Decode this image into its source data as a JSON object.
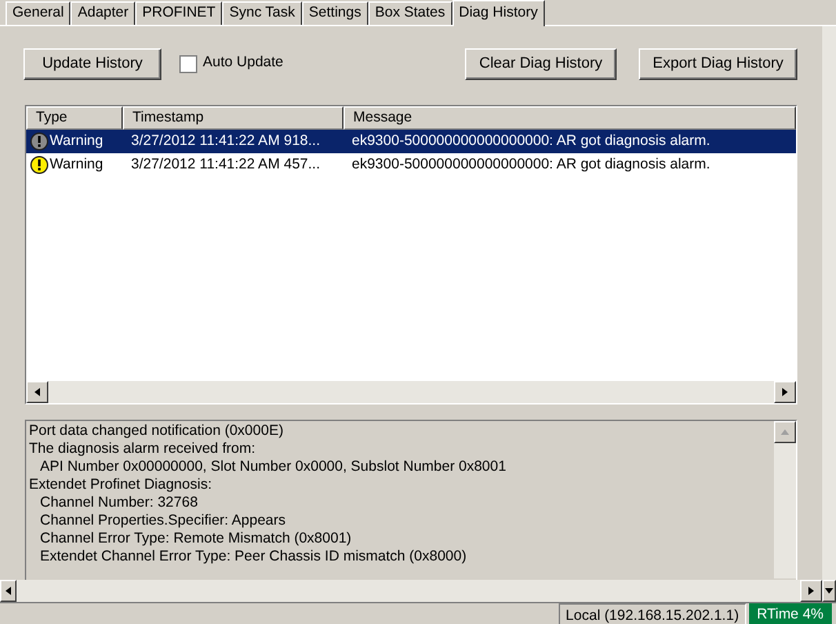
{
  "tabs": [
    {
      "label": "General",
      "selected": false
    },
    {
      "label": "Adapter",
      "selected": false
    },
    {
      "label": "PROFINET",
      "selected": false
    },
    {
      "label": "Sync Task",
      "selected": false
    },
    {
      "label": "Settings",
      "selected": false
    },
    {
      "label": "Box States",
      "selected": false
    },
    {
      "label": "Diag History",
      "selected": true
    }
  ],
  "toolbar": {
    "update_button": "Update History",
    "auto_update": {
      "label": "Auto Update",
      "checked": false
    },
    "clear_button": "Clear Diag History",
    "export_button": "Export Diag History"
  },
  "table": {
    "columns": [
      "Type",
      "Timestamp",
      "Message"
    ],
    "rows": [
      {
        "type": "Warning",
        "timestamp": "3/27/2012 11:41:22 AM 918...",
        "message": "ek9300-500000000000000000: AR got diagnosis alarm.",
        "selected": true
      },
      {
        "type": "Warning",
        "timestamp": "3/27/2012 11:41:22 AM 457...",
        "message": "ek9300-500000000000000000: AR got diagnosis alarm.",
        "selected": false
      }
    ]
  },
  "details": [
    {
      "text": "Port data changed notification (0x000E)"
    },
    {
      "text": "The diagnosis alarm received from:",
      "children": [
        {
          "text": "API Number 0x00000000, Slot Number 0x0000, Subslot Number 0x8001"
        }
      ]
    },
    {
      "text": "Extendet Profinet Diagnosis:",
      "children": [
        {
          "text": "Channel Number: 32768"
        },
        {
          "text": "Channel Properties.Specifier: Appears"
        },
        {
          "text": "Channel Error Type: Remote Mismatch (0x8001)"
        },
        {
          "text": "Extendet Channel Error Type: Peer Chassis ID mismatch (0x8000)"
        }
      ]
    }
  ],
  "status_bar": {
    "connection": "Local (192.168.15.202.1.1)",
    "rtime": "RTime 4%"
  }
}
